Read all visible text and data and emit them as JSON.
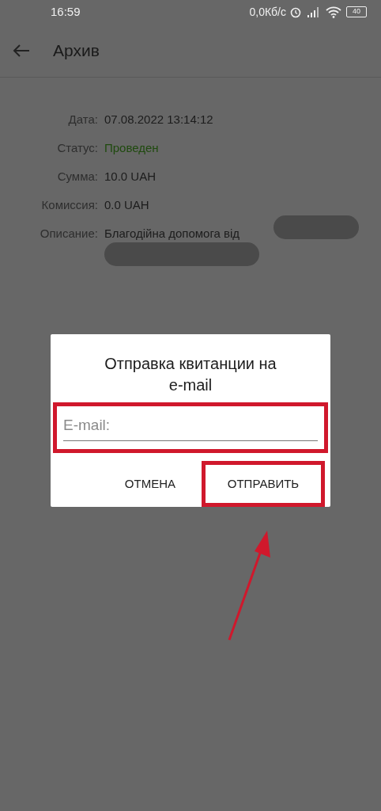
{
  "status_bar": {
    "time": "16:59",
    "network_speed": "0,0Кб/с",
    "battery": "40"
  },
  "app_bar": {
    "title": "Архив"
  },
  "details": [
    {
      "label": "Дата:",
      "value": "07.08.2022 13:14:12",
      "kind": "plain"
    },
    {
      "label": "Статус:",
      "value": "Проведен",
      "kind": "status"
    },
    {
      "label": "Сумма:",
      "value": "10.0 UAH",
      "kind": "plain"
    },
    {
      "label": "Комиссия:",
      "value": "0.0 UAH",
      "kind": "plain"
    },
    {
      "label": "Описание:",
      "value": "Благодійна допомога від",
      "kind": "redacted"
    }
  ],
  "dialog": {
    "title": "Отправка квитанции на e-mail",
    "email_field": {
      "placeholder": "E-mail:",
      "highlighted": true
    },
    "buttons": [
      {
        "label": "ОТМЕНА",
        "highlighted": false
      },
      {
        "label": "ОТПРАВИТЬ",
        "highlighted": true
      }
    ]
  }
}
